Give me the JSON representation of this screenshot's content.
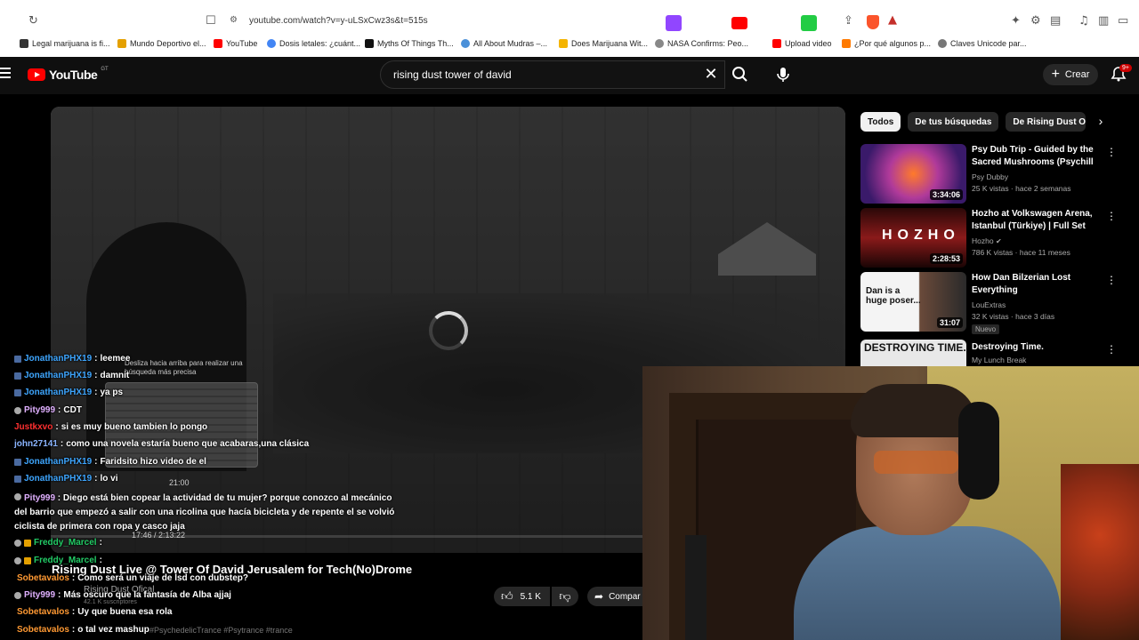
{
  "browser": {
    "url": "youtube.com/watch?v=y-uLSxCwz3s&t=515s",
    "bookmarks": [
      "Legal marijuana is fi...",
      "Mundo Deportivo el...",
      "YouTube",
      "Dosis letales: ¿cuánt...",
      "Myths Of Things Th...",
      "All About Mudras –...",
      "Does Marijuana Wit...",
      "NASA Confirms: Peo...",
      "Upload video",
      "¿Por qué algunos p...",
      "Claves Unicode par..."
    ],
    "colors": {
      "twitch": "#9146ff",
      "youtube": "#ff0000",
      "green_ext": "#22cc44"
    }
  },
  "header": {
    "logo_text": "YouTube",
    "country_code": "GT",
    "search_value": "rising dust tower of david",
    "create_label": "Crear",
    "notif_count": "9+"
  },
  "player": {
    "title_overlay": "Rising Dust Live @ Tower Of David Jerusalem for Tech(No)Drome",
    "hint_text": "Desliza hacia arriba para realizar una búsqueda más precisa",
    "preview_time": "21:00",
    "time_display": "17:46 / 2:13:22",
    "channel_ghost": "Rising Dust Ofical",
    "subs_ghost": "42.1 K suscriptores",
    "likes": "5.1 K",
    "share_label": "Compar",
    "hashtags": "#PsychedelicTrance #Psytrance #trance"
  },
  "chat": [
    {
      "user": "JonathanPHX19",
      "color": "#3ea6ff",
      "msg": "leemee"
    },
    {
      "user": "JonathanPHX19",
      "color": "#3ea6ff",
      "msg": "damnit"
    },
    {
      "user": "JonathanPHX19",
      "color": "#3ea6ff",
      "msg": "ya ps"
    },
    {
      "user": "Pity999",
      "color": "#e0b0ff",
      "msg": "CDT"
    },
    {
      "user": "Justkxvo",
      "color": "#ff3030",
      "msg": "si es muy bueno tambien lo pongo"
    },
    {
      "user": "john27141",
      "color": "#8ab4ff",
      "msg": "como una novela estaría bueno que acabaras,una clásica"
    },
    {
      "user": "JonathanPHX19",
      "color": "#3ea6ff",
      "msg": "Faridsito hizo video de el"
    },
    {
      "user": "JonathanPHX19",
      "color": "#3ea6ff",
      "msg": "lo vi"
    },
    {
      "user": "Pity999",
      "color": "#e0b0ff",
      "msg": "Diego está bien copear la actividad de tu mujer? porque conozco al mecánico del barrio que empezó a salir con una ricolina que hacía bicicleta y de repente el se volvió ciclista de primera con ropa y casco jaja"
    },
    {
      "user": "Freddy_Marcel",
      "color": "#22cc66",
      "msg": ""
    },
    {
      "user": "Freddy_Marcel",
      "color": "#22cc66",
      "msg": ""
    },
    {
      "user": "Sobetavalos",
      "color": "#ff9933",
      "msg": "Como será un viaje de lsd con dubstep?"
    },
    {
      "user": "Pity999",
      "color": "#e0b0ff",
      "msg": "Más oscuro que la fantasía de Alba ajjaj"
    },
    {
      "user": "Sobetavalos",
      "color": "#ff9933",
      "msg": "Uy que buena esa rola"
    },
    {
      "user": "Sobetavalos",
      "color": "#ff9933",
      "msg": "o tal vez mashup"
    }
  ],
  "chips": [
    "Todos",
    "De tus búsquedas",
    "De Rising Dust Offi"
  ],
  "recommendations": [
    {
      "title": "Psy Dub Trip - Guided by the Sacred Mushrooms (Psychill ...",
      "channel": "Psy Dubby",
      "meta": "25 K vistas · hace 2 semanas",
      "duration": "3:34:06",
      "thumb_color": "#7a2a9a"
    },
    {
      "title": "Hozho at Volkswagen Arena, Istanbul (Türkiye) | Full Set",
      "channel": "Hozho",
      "meta": "786 K vistas · hace 11 meses",
      "duration": "2:28:53",
      "thumb_color": "#8a1a1a"
    },
    {
      "title": "How Dan Bilzerian Lost Everything",
      "channel": "LouExtras",
      "meta": "32 K vistas · hace 3 días",
      "duration": "31:07",
      "badge": "Nuevo",
      "thumb_color": "#cfcfcf"
    },
    {
      "title": "Destroying Time.",
      "channel": "My Lunch Break",
      "meta": "",
      "duration": "",
      "thumb_color": "#d8d8d8"
    }
  ]
}
